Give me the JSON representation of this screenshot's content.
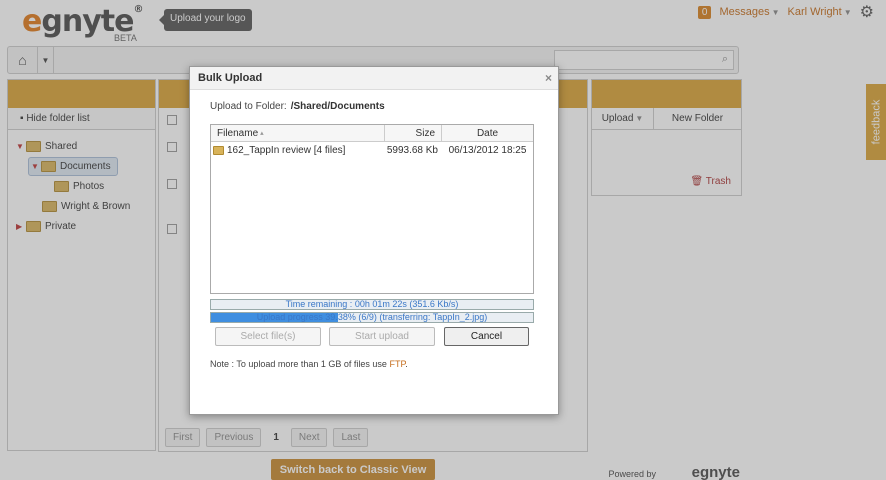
{
  "header": {
    "logo_prefix": "e",
    "logo_rest": "gnyte",
    "logo_mark": "®",
    "logo_badge": "BETA",
    "upload_logo_tip": "Upload your logo",
    "messages_count": "0",
    "messages_label": "Messages",
    "user_name": "Karl Wright"
  },
  "sidebar": {
    "hide_label": "Hide folder list",
    "items": [
      {
        "label": "Shared"
      },
      {
        "label": "Documents"
      },
      {
        "label": "Photos"
      },
      {
        "label": "Wright & Brown"
      },
      {
        "label": "Private"
      }
    ]
  },
  "right_panel": {
    "upload_label": "Upload",
    "new_folder_label": "New Folder",
    "trash_label": "Trash"
  },
  "pagination": {
    "first": "First",
    "previous": "Previous",
    "current": "1",
    "next": "Next",
    "last": "Last"
  },
  "footer": {
    "classic_view": "Switch back to Classic View",
    "powered_by": "Powered by",
    "powered_logo": "egnyte"
  },
  "feedback": "feedback",
  "dialog": {
    "title": "Bulk Upload",
    "upload_to_label": "Upload to Folder:",
    "upload_to_path": "/Shared/Documents",
    "columns": {
      "filename": "Filename",
      "size": "Size",
      "date": "Date"
    },
    "files": [
      {
        "name": "162_TappIn review [4 files]",
        "size": "5993.68 Kb",
        "date": "06/13/2012 18:25"
      }
    ],
    "time_remaining": "Time remaining : 00h 01m 22s (351.6 Kb/s)",
    "upload_progress": "Upload progress 39.38% (6/9) (transferring: TappIn_2.jpg)",
    "progress_percent": 39.38,
    "select_files_label": "Select file(s)",
    "start_upload_label": "Start upload",
    "cancel_label": "Cancel",
    "note_text": "Note : To upload more than 1 GB of files use",
    "note_link": "FTP",
    "note_end": "."
  },
  "colors": {
    "accent": "#d9a336",
    "brand": "#e07a1a",
    "progress": "#3f8ee0"
  }
}
